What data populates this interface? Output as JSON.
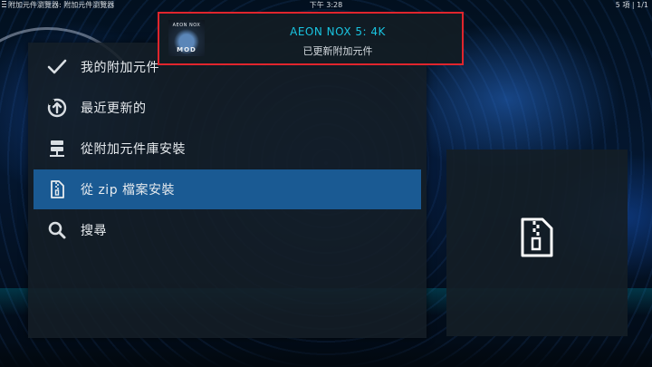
{
  "topbar": {
    "breadcrumb": "附加元件瀏覽器: 附加元件瀏覽器",
    "clock": "下午 3:28",
    "item_count": "5 項 | 1/1"
  },
  "menu": {
    "items": [
      {
        "label": "我的附加元件",
        "icon": "checkmark-icon"
      },
      {
        "label": "最近更新的",
        "icon": "refresh-upload-icon"
      },
      {
        "label": "從附加元件庫安裝",
        "icon": "server-icon"
      },
      {
        "label": "從 zip 檔案安裝",
        "icon": "zip-file-icon",
        "selected": true
      },
      {
        "label": "搜尋",
        "icon": "search-icon"
      }
    ]
  },
  "preview": {
    "icon": "zip-file-icon"
  },
  "notification": {
    "title": "AEON NOX 5: 4K",
    "message": "已更新附加元件",
    "thumb_top": "AEON NOX",
    "thumb_bottom": "MOD",
    "border_color": "#e0252d",
    "title_color": "#19c4e0"
  },
  "colors": {
    "selected_bg": "#1a5a93",
    "panel_bg": "#141e26"
  }
}
